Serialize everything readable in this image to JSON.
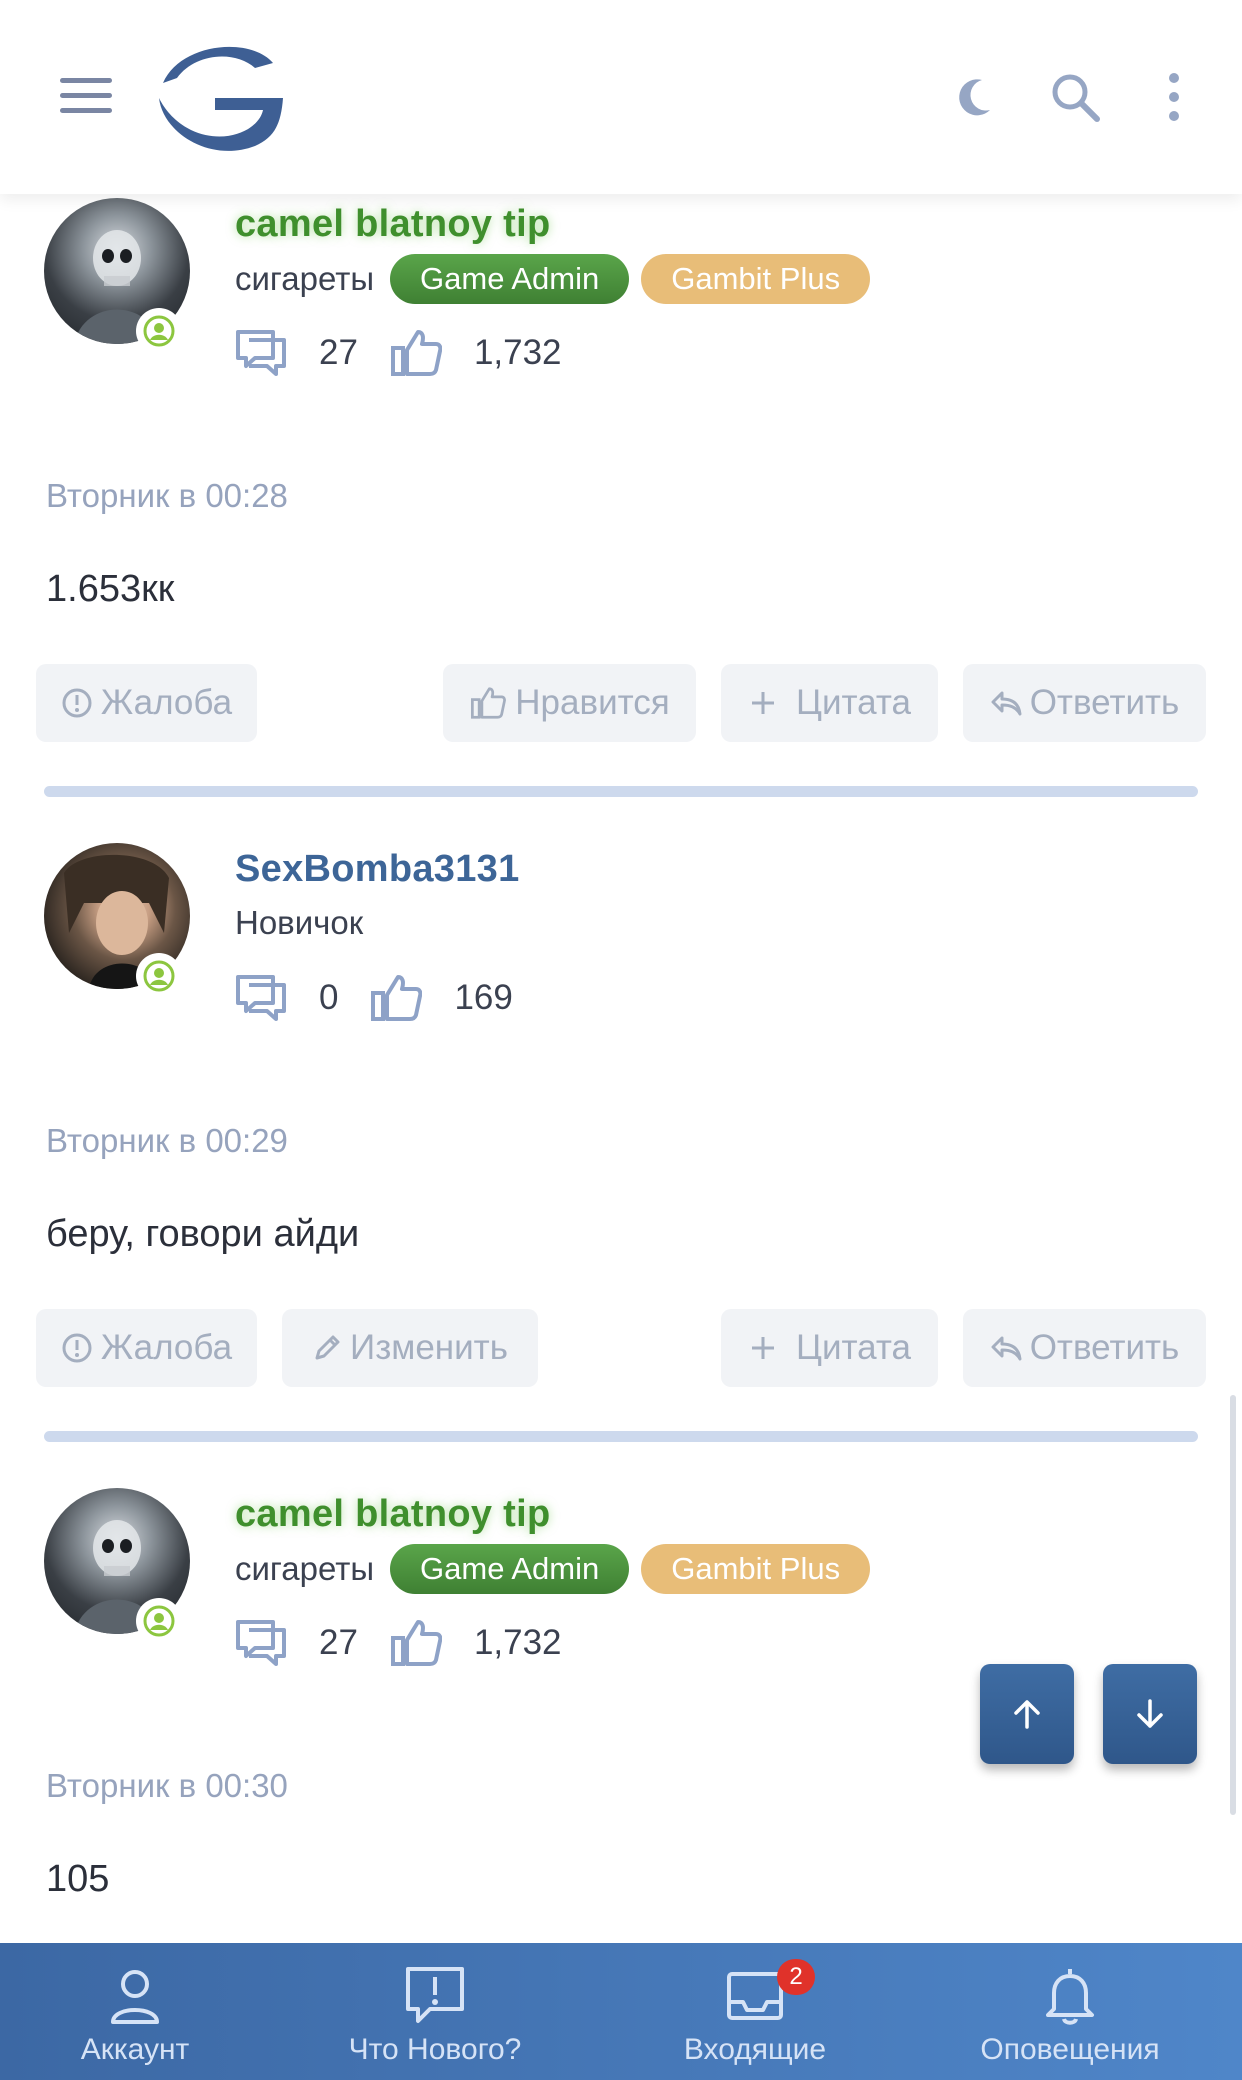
{
  "header": {
    "menu_icon": "hamburger-menu-icon",
    "logo_icon": "gambit-logo-icon",
    "theme_icon": "moon-icon",
    "search_icon": "search-icon",
    "more_icon": "more-vertical-icon"
  },
  "posts": [
    {
      "username": "camel blatnoy tip",
      "user_title": "сигареты",
      "badges": [
        "Game Admin",
        "Gambit Plus"
      ],
      "message_count": "27",
      "reaction_score": "1,732",
      "date": "Вторник в 00:28",
      "message": "1.653кк",
      "actions": {
        "report": "Жалоба",
        "like": "Нравится",
        "quote": "Цитата",
        "reply": "Ответить"
      }
    },
    {
      "username": "SexBomba3131",
      "user_title": "Новичок",
      "message_count": "0",
      "reaction_score": "169",
      "date": "Вторник в 00:29",
      "message": "беру, говори айди",
      "actions": {
        "report": "Жалоба",
        "edit": "Изменить",
        "quote": "Цитата",
        "reply": "Ответить"
      }
    },
    {
      "username": "camel blatnoy tip",
      "user_title": "сигареты",
      "badges": [
        "Game Admin",
        "Gambit Plus"
      ],
      "message_count": "27",
      "reaction_score": "1,732",
      "date": "Вторник в 00:30",
      "message": "105"
    }
  ],
  "bottom_nav": [
    {
      "label": "Аккаунт",
      "icon": "user-icon"
    },
    {
      "label": "Что Нового?",
      "icon": "whats-new-icon"
    },
    {
      "label": "Входящие",
      "icon": "inbox-icon",
      "badge": "2"
    },
    {
      "label": "Оповещения",
      "icon": "bell-icon"
    }
  ],
  "colors": {
    "accent": "#3d6597",
    "admin_name": "#3f8f2d",
    "admin_badge": "#4f9a41",
    "plus_badge": "#e8bd78",
    "nav_bg": "#4577b6",
    "notification": "#e0322a"
  }
}
